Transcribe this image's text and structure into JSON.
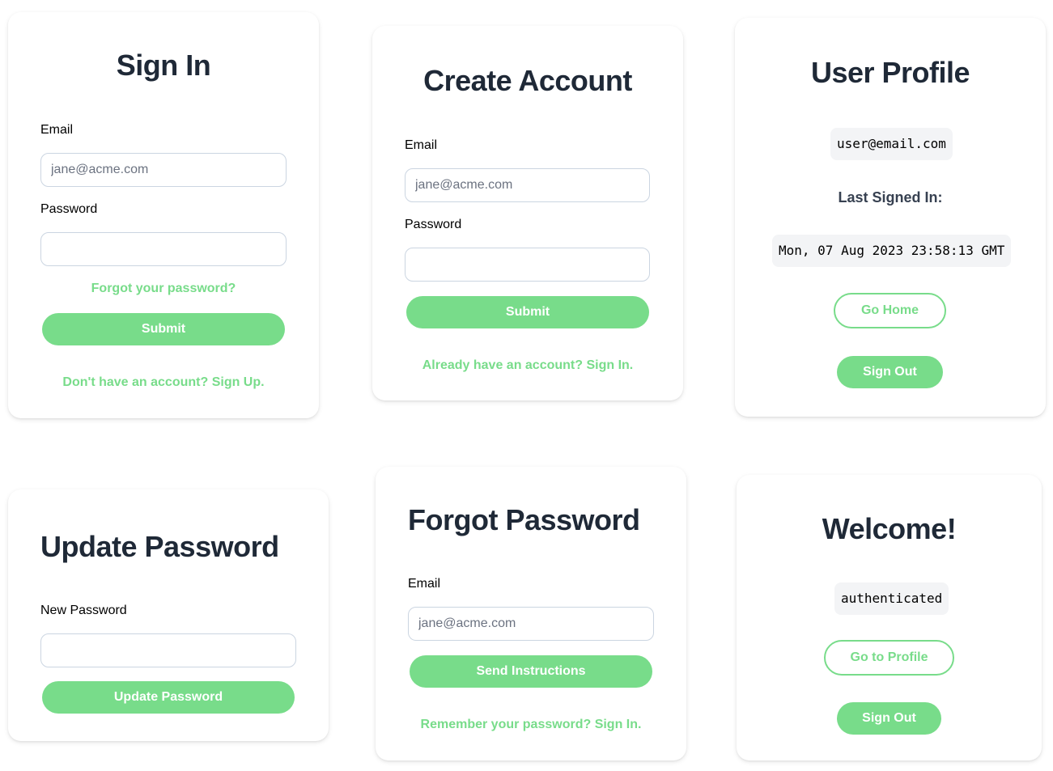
{
  "theme": {
    "accent": "#78dc8a",
    "heading": "#1f2937",
    "input_border": "#cbd5e1",
    "code_bg": "#f3f4f6"
  },
  "sign_in": {
    "title": "Sign In",
    "email_label": "Email",
    "email_placeholder": "jane@acme.com",
    "email_value": "",
    "password_label": "Password",
    "password_value": "",
    "forgot_link": "Forgot your password?",
    "submit_label": "Submit",
    "signup_link": "Don't have an account? Sign Up."
  },
  "create_account": {
    "title": "Create Account",
    "email_label": "Email",
    "email_placeholder": "jane@acme.com",
    "email_value": "",
    "password_label": "Password",
    "password_value": "",
    "submit_label": "Submit",
    "signin_link": "Already have an account? Sign In."
  },
  "user_profile": {
    "title": "User Profile",
    "email": "user@email.com",
    "last_signed_in_label": "Last Signed In:",
    "last_signed_in_value": "Mon, 07 Aug 2023 23:58:13 GMT",
    "go_home_label": "Go Home",
    "sign_out_label": "Sign Out"
  },
  "update_password": {
    "title": "Update Password",
    "new_password_label": "New Password",
    "new_password_value": "",
    "submit_label": "Update Password"
  },
  "forgot_password": {
    "title": "Forgot Password",
    "email_label": "Email",
    "email_placeholder": "jane@acme.com",
    "email_value": "",
    "submit_label": "Send Instructions",
    "signin_link": "Remember your password? Sign In."
  },
  "welcome": {
    "title": "Welcome!",
    "status": "authenticated",
    "go_profile_label": "Go to Profile",
    "sign_out_label": "Sign Out"
  }
}
